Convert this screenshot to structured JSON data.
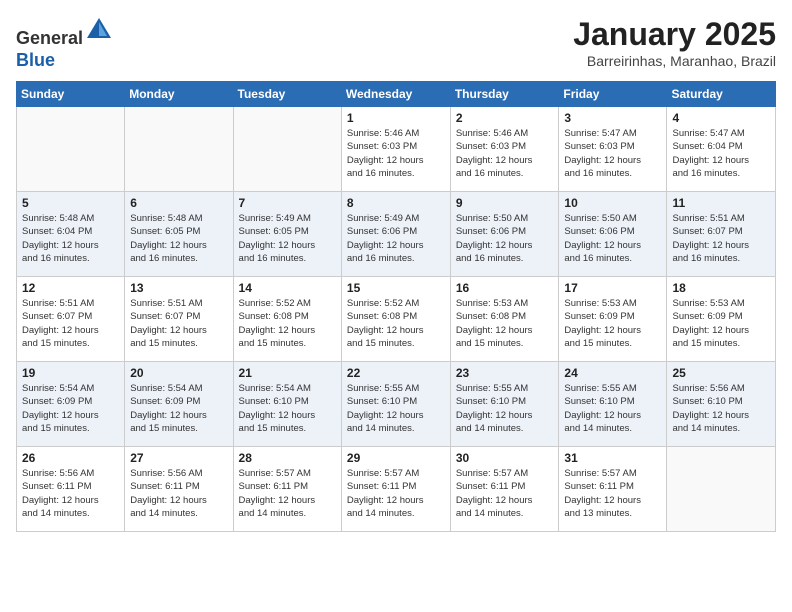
{
  "header": {
    "logo_general": "General",
    "logo_blue": "Blue",
    "month_title": "January 2025",
    "location": "Barreirinhas, Maranhao, Brazil"
  },
  "weekdays": [
    "Sunday",
    "Monday",
    "Tuesday",
    "Wednesday",
    "Thursday",
    "Friday",
    "Saturday"
  ],
  "weeks": [
    [
      {
        "day": "",
        "info": ""
      },
      {
        "day": "",
        "info": ""
      },
      {
        "day": "",
        "info": ""
      },
      {
        "day": "1",
        "info": "Sunrise: 5:46 AM\nSunset: 6:03 PM\nDaylight: 12 hours\nand 16 minutes."
      },
      {
        "day": "2",
        "info": "Sunrise: 5:46 AM\nSunset: 6:03 PM\nDaylight: 12 hours\nand 16 minutes."
      },
      {
        "day": "3",
        "info": "Sunrise: 5:47 AM\nSunset: 6:03 PM\nDaylight: 12 hours\nand 16 minutes."
      },
      {
        "day": "4",
        "info": "Sunrise: 5:47 AM\nSunset: 6:04 PM\nDaylight: 12 hours\nand 16 minutes."
      }
    ],
    [
      {
        "day": "5",
        "info": "Sunrise: 5:48 AM\nSunset: 6:04 PM\nDaylight: 12 hours\nand 16 minutes."
      },
      {
        "day": "6",
        "info": "Sunrise: 5:48 AM\nSunset: 6:05 PM\nDaylight: 12 hours\nand 16 minutes."
      },
      {
        "day": "7",
        "info": "Sunrise: 5:49 AM\nSunset: 6:05 PM\nDaylight: 12 hours\nand 16 minutes."
      },
      {
        "day": "8",
        "info": "Sunrise: 5:49 AM\nSunset: 6:06 PM\nDaylight: 12 hours\nand 16 minutes."
      },
      {
        "day": "9",
        "info": "Sunrise: 5:50 AM\nSunset: 6:06 PM\nDaylight: 12 hours\nand 16 minutes."
      },
      {
        "day": "10",
        "info": "Sunrise: 5:50 AM\nSunset: 6:06 PM\nDaylight: 12 hours\nand 16 minutes."
      },
      {
        "day": "11",
        "info": "Sunrise: 5:51 AM\nSunset: 6:07 PM\nDaylight: 12 hours\nand 16 minutes."
      }
    ],
    [
      {
        "day": "12",
        "info": "Sunrise: 5:51 AM\nSunset: 6:07 PM\nDaylight: 12 hours\nand 15 minutes."
      },
      {
        "day": "13",
        "info": "Sunrise: 5:51 AM\nSunset: 6:07 PM\nDaylight: 12 hours\nand 15 minutes."
      },
      {
        "day": "14",
        "info": "Sunrise: 5:52 AM\nSunset: 6:08 PM\nDaylight: 12 hours\nand 15 minutes."
      },
      {
        "day": "15",
        "info": "Sunrise: 5:52 AM\nSunset: 6:08 PM\nDaylight: 12 hours\nand 15 minutes."
      },
      {
        "day": "16",
        "info": "Sunrise: 5:53 AM\nSunset: 6:08 PM\nDaylight: 12 hours\nand 15 minutes."
      },
      {
        "day": "17",
        "info": "Sunrise: 5:53 AM\nSunset: 6:09 PM\nDaylight: 12 hours\nand 15 minutes."
      },
      {
        "day": "18",
        "info": "Sunrise: 5:53 AM\nSunset: 6:09 PM\nDaylight: 12 hours\nand 15 minutes."
      }
    ],
    [
      {
        "day": "19",
        "info": "Sunrise: 5:54 AM\nSunset: 6:09 PM\nDaylight: 12 hours\nand 15 minutes."
      },
      {
        "day": "20",
        "info": "Sunrise: 5:54 AM\nSunset: 6:09 PM\nDaylight: 12 hours\nand 15 minutes."
      },
      {
        "day": "21",
        "info": "Sunrise: 5:54 AM\nSunset: 6:10 PM\nDaylight: 12 hours\nand 15 minutes."
      },
      {
        "day": "22",
        "info": "Sunrise: 5:55 AM\nSunset: 6:10 PM\nDaylight: 12 hours\nand 14 minutes."
      },
      {
        "day": "23",
        "info": "Sunrise: 5:55 AM\nSunset: 6:10 PM\nDaylight: 12 hours\nand 14 minutes."
      },
      {
        "day": "24",
        "info": "Sunrise: 5:55 AM\nSunset: 6:10 PM\nDaylight: 12 hours\nand 14 minutes."
      },
      {
        "day": "25",
        "info": "Sunrise: 5:56 AM\nSunset: 6:10 PM\nDaylight: 12 hours\nand 14 minutes."
      }
    ],
    [
      {
        "day": "26",
        "info": "Sunrise: 5:56 AM\nSunset: 6:11 PM\nDaylight: 12 hours\nand 14 minutes."
      },
      {
        "day": "27",
        "info": "Sunrise: 5:56 AM\nSunset: 6:11 PM\nDaylight: 12 hours\nand 14 minutes."
      },
      {
        "day": "28",
        "info": "Sunrise: 5:57 AM\nSunset: 6:11 PM\nDaylight: 12 hours\nand 14 minutes."
      },
      {
        "day": "29",
        "info": "Sunrise: 5:57 AM\nSunset: 6:11 PM\nDaylight: 12 hours\nand 14 minutes."
      },
      {
        "day": "30",
        "info": "Sunrise: 5:57 AM\nSunset: 6:11 PM\nDaylight: 12 hours\nand 14 minutes."
      },
      {
        "day": "31",
        "info": "Sunrise: 5:57 AM\nSunset: 6:11 PM\nDaylight: 12 hours\nand 13 minutes."
      },
      {
        "day": "",
        "info": ""
      }
    ]
  ]
}
